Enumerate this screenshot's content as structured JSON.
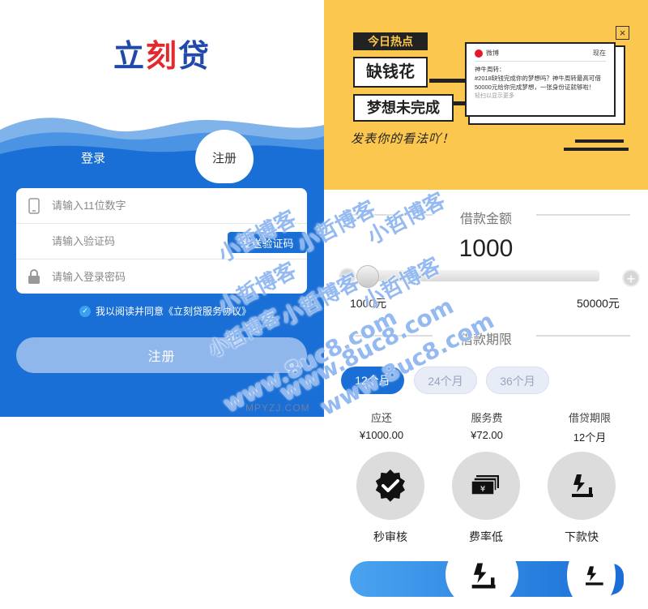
{
  "left": {
    "logo": {
      "part1": "立",
      "part2": "刻",
      "part3": "贷"
    },
    "tabs": {
      "login": "登录",
      "register": "注册"
    },
    "fields": {
      "phone_placeholder": "请输入11位数字",
      "code_placeholder": "请输入验证码",
      "password_placeholder": "请输入登录密码"
    },
    "send_code": "发送验证码",
    "agree_text": "我以阅读并同意《立刻贷服务协议》",
    "register_button": "注册",
    "credit": "MPYZJ.COM"
  },
  "right": {
    "banner": {
      "tag": "今日热点",
      "headline1": "缺钱花",
      "headline2": "梦想未完成",
      "comment": "发表你的看法吖！",
      "close": "×",
      "card": {
        "source": "微博",
        "time": "现在",
        "author": "神牛周转：",
        "text": "#2018缺钱完成你的梦想吗？神牛周转最高可借50000元给你完成梦想，一张身份证就够啦！",
        "more": "轻扫以显示更多"
      }
    },
    "amount_section": {
      "title": "借款金额",
      "value": "1000",
      "slider_fraction": 0,
      "min_label": "1000元",
      "max_label": "50000元",
      "minus": "−",
      "plus": "+"
    },
    "term_section": {
      "title": "借款期限",
      "options": [
        "12个月",
        "24个月",
        "36个月"
      ],
      "selected": "12个月"
    },
    "summary": [
      {
        "label": "应还",
        "value": "¥1000.00"
      },
      {
        "label": "服务费",
        "value": "¥72.00"
      },
      {
        "label": "借贷期限",
        "value": "12个月"
      }
    ],
    "features": [
      {
        "label": "秒审核",
        "icon": "badge-check-icon"
      },
      {
        "label": "费率低",
        "icon": "money-stack-icon"
      },
      {
        "label": "下款快",
        "icon": "download-icon"
      }
    ]
  },
  "watermarks": {
    "brand": "小哲博客",
    "site": "www.8uc8.com"
  },
  "colors": {
    "primary_blue": "#1a6fd6",
    "banner_yellow": "#fcc74f",
    "logo_blue": "#2049a8",
    "logo_red": "#e5282e"
  }
}
